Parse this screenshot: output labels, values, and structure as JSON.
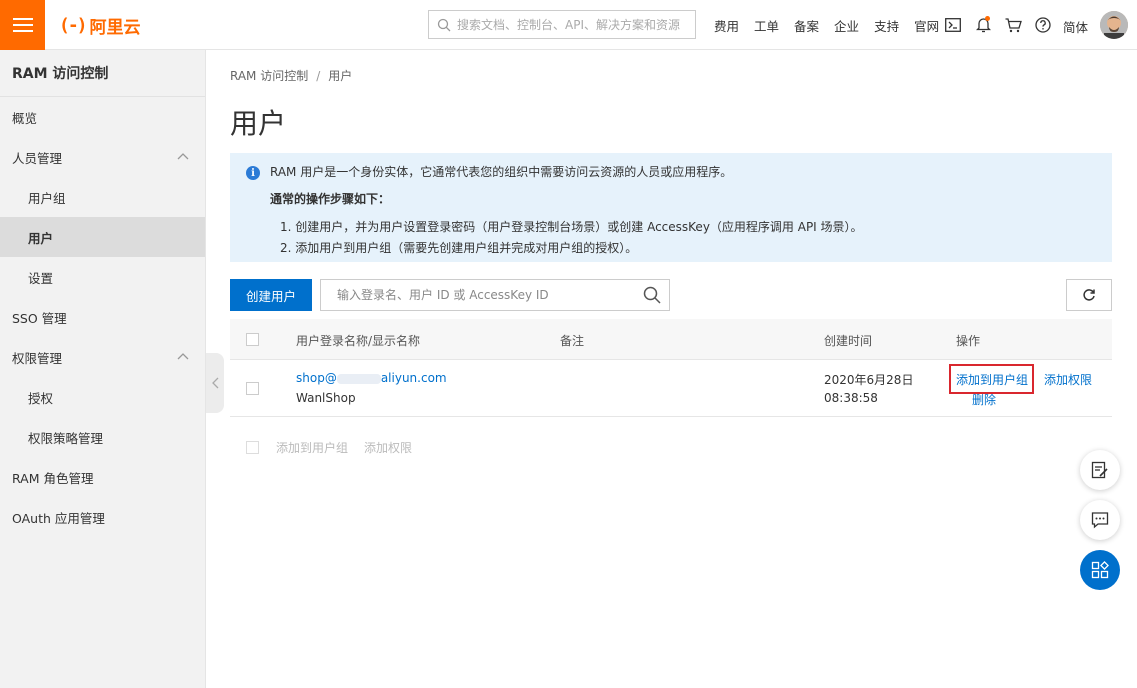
{
  "header": {
    "logo_mark": "(-)",
    "logo_text": "阿里云",
    "search_placeholder": "搜索文档、控制台、API、解决方案和资源",
    "nav": [
      "费用",
      "工单",
      "备案",
      "企业",
      "支持",
      "官网"
    ],
    "lang": "简体",
    "icons": [
      "terminal-icon",
      "bell-icon",
      "cart-icon",
      "help-icon"
    ]
  },
  "sidebar": {
    "title": "RAM 访问控制",
    "items": [
      {
        "label": "概览",
        "sub": false
      },
      {
        "label": "人员管理",
        "sub": false,
        "expandable": true
      },
      {
        "label": "用户组",
        "sub": true
      },
      {
        "label": "用户",
        "sub": true,
        "active": true
      },
      {
        "label": "设置",
        "sub": true
      },
      {
        "label": "SSO 管理",
        "sub": false
      },
      {
        "label": "权限管理",
        "sub": false,
        "expandable": true
      },
      {
        "label": "授权",
        "sub": true
      },
      {
        "label": "权限策略管理",
        "sub": true
      },
      {
        "label": "RAM 角色管理",
        "sub": false
      },
      {
        "label": "OAuth 应用管理",
        "sub": false
      }
    ]
  },
  "breadcrumb": {
    "root": "RAM 访问控制",
    "separator": "/",
    "current": "用户"
  },
  "page_title": "用户",
  "info": {
    "line1": "RAM 用户是一个身份实体，它通常代表您的组织中需要访问云资源的人员或应用程序。",
    "line2": "通常的操作步骤如下：",
    "line3": "1. 创建用户，并为用户设置登录密码（用户登录控制台场景）或创建 AccessKey（应用程序调用 API 场景）。",
    "line4": "2. 添加用户到用户组（需要先创建用户组并完成对用户组的授权）。"
  },
  "toolbar": {
    "create_label": "创建用户",
    "search_placeholder": "输入登录名、用户 ID 或 AccessKey ID"
  },
  "table": {
    "headers": {
      "name": "用户登录名称/显示名称",
      "note": "备注",
      "created": "创建时间",
      "actions": "操作"
    },
    "rows": [
      {
        "login_prefix": "shop@",
        "login_suffix": "aliyun.com",
        "display": "WanlShop",
        "note": "",
        "created_date": "2020年6月28日",
        "created_time": "08:38:58",
        "action_add_group": "添加到用户组",
        "action_add_perm": "添加权限",
        "action_delete": "删除"
      }
    ]
  },
  "batch": {
    "add_group": "添加到用户组",
    "add_perm": "添加权限"
  },
  "colors": {
    "brand": "#ff6a00",
    "primary": "#0070cc",
    "highlight": "#d9272e",
    "info_bg": "#e6f2fb"
  }
}
